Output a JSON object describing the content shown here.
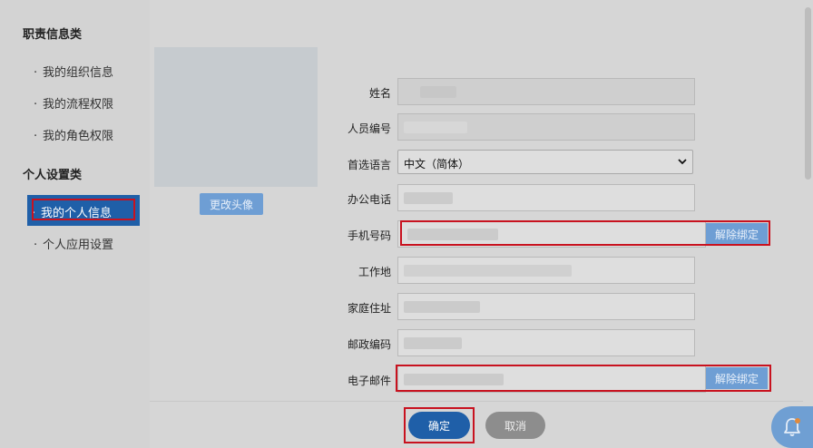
{
  "sidebar": {
    "group1_title": "职责信息类",
    "group1_items": [
      {
        "dot": "·",
        "label": "我的组织信息"
      },
      {
        "dot": "·",
        "label": "我的流程权限"
      },
      {
        "dot": "·",
        "label": "我的角色权限"
      }
    ],
    "group2_title": "个人设置类",
    "group2_items": [
      {
        "dot": "·",
        "label": "我的个人信息",
        "active": true
      },
      {
        "dot": "·",
        "label": "个人应用设置"
      }
    ]
  },
  "avatar": {
    "change_label": "更改头像"
  },
  "form": {
    "name_label": "姓名",
    "employee_id_label": "人员编号",
    "language_label": "首选语言",
    "language_value": "中文（简体）",
    "office_phone_label": "办公电话",
    "mobile_label": "手机号码",
    "workplace_label": "工作地",
    "home_address_label": "家庭住址",
    "postal_code_label": "邮政编码",
    "email_label": "电子邮件",
    "unbind_label": "解除绑定"
  },
  "footer": {
    "ok_label": "确定",
    "cancel_label": "取消"
  },
  "colors": {
    "accent": "#1f5fa8",
    "highlight_red": "#c8121f",
    "button_light_blue": "#6e9ed4"
  },
  "icons": {
    "select_chevron": "chevron-down-icon",
    "notification": "bell-icon"
  }
}
